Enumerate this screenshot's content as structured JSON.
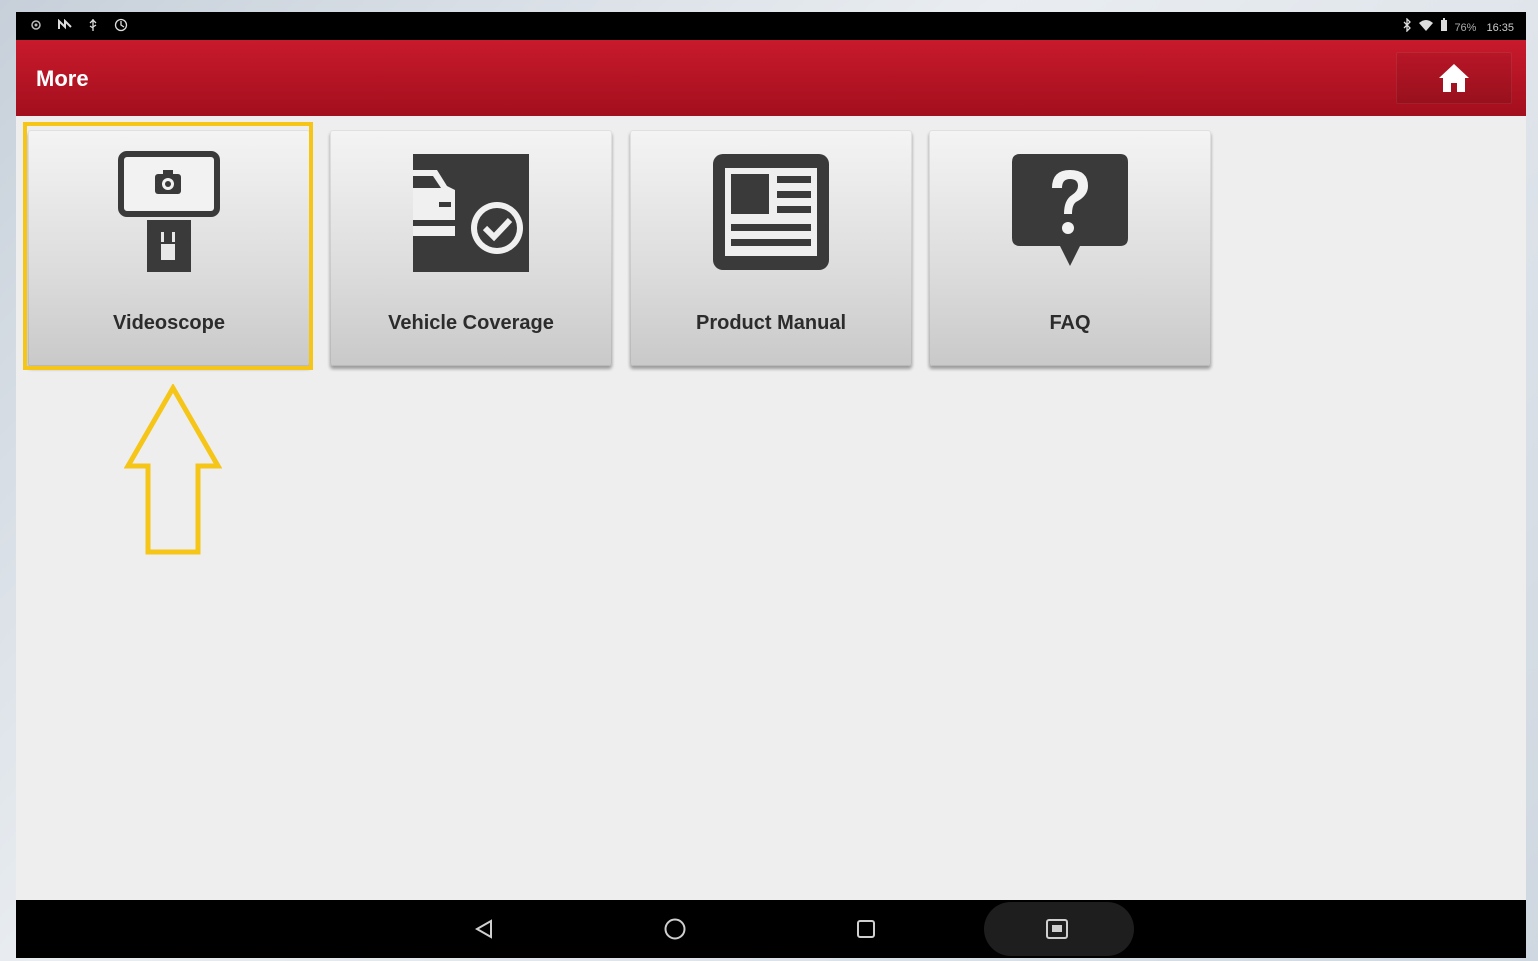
{
  "status_bar": {
    "left_icons": [
      "settings-icon",
      "notification-icon",
      "usb-icon",
      "sync-icon"
    ],
    "right_icons": [
      "bluetooth-icon",
      "wifi-icon",
      "battery-icon"
    ],
    "battery_text": "76%",
    "time": "16:35"
  },
  "header": {
    "title": "More",
    "home_icon": "home-icon"
  },
  "tiles": [
    {
      "label": "Videoscope",
      "icon": "videoscope-icon"
    },
    {
      "label": "Vehicle Coverage",
      "icon": "vehicle-coverage-icon"
    },
    {
      "label": "Product Manual",
      "icon": "product-manual-icon"
    },
    {
      "label": "FAQ",
      "icon": "faq-icon"
    }
  ],
  "annotation": {
    "highlight_color": "#f5c518",
    "arrow_icon": "up-arrow-icon"
  },
  "nav_bar": {
    "buttons": [
      "back-icon",
      "home-circle-icon",
      "recents-icon",
      "screenshot-icon"
    ]
  },
  "colors": {
    "header_red": "#c81a2c",
    "tile_gray": "#dcdcdc",
    "icon_dark": "#3a3a3a"
  }
}
